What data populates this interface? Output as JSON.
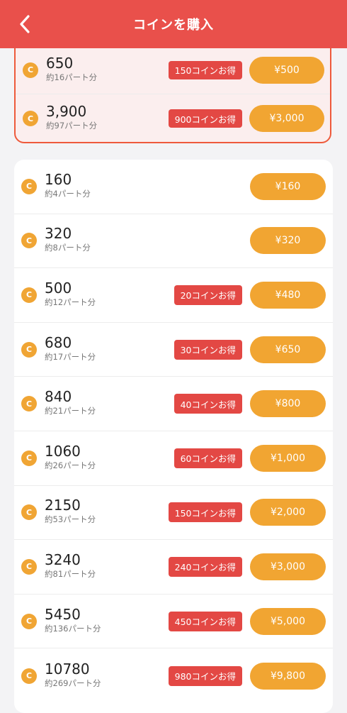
{
  "header": {
    "title": "コインを購入"
  },
  "featured": [
    {
      "coins": "650",
      "parts": "約16パート分",
      "bonus": "150コインお得",
      "price": "¥500"
    },
    {
      "coins": "3,900",
      "parts": "約97パート分",
      "bonus": "900コインお得",
      "price": "¥3,000"
    }
  ],
  "packages": [
    {
      "coins": "160",
      "parts": "約4パート分",
      "bonus": "",
      "price": "¥160"
    },
    {
      "coins": "320",
      "parts": "約8パート分",
      "bonus": "",
      "price": "¥320"
    },
    {
      "coins": "500",
      "parts": "約12パート分",
      "bonus": "20コインお得",
      "price": "¥480"
    },
    {
      "coins": "680",
      "parts": "約17パート分",
      "bonus": "30コインお得",
      "price": "¥650"
    },
    {
      "coins": "840",
      "parts": "約21パート分",
      "bonus": "40コインお得",
      "price": "¥800"
    },
    {
      "coins": "1060",
      "parts": "約26パート分",
      "bonus": "60コインお得",
      "price": "¥1,000"
    },
    {
      "coins": "2150",
      "parts": "約53パート分",
      "bonus": "150コインお得",
      "price": "¥2,000"
    },
    {
      "coins": "3240",
      "parts": "約81パート分",
      "bonus": "240コインお得",
      "price": "¥3,000"
    },
    {
      "coins": "5450",
      "parts": "約136パート分",
      "bonus": "450コインお得",
      "price": "¥5,000"
    },
    {
      "coins": "10780",
      "parts": "約269パート分",
      "bonus": "980コインお得",
      "price": "¥9,800"
    }
  ],
  "coin_icon_letter": "C",
  "colors": {
    "header": "#e9504b",
    "coin": "#f0a534",
    "price_button": "#f1a532",
    "bonus_badge": "#e34844",
    "featured_border": "#ee5a3b",
    "featured_bg": "#fbeeee"
  }
}
